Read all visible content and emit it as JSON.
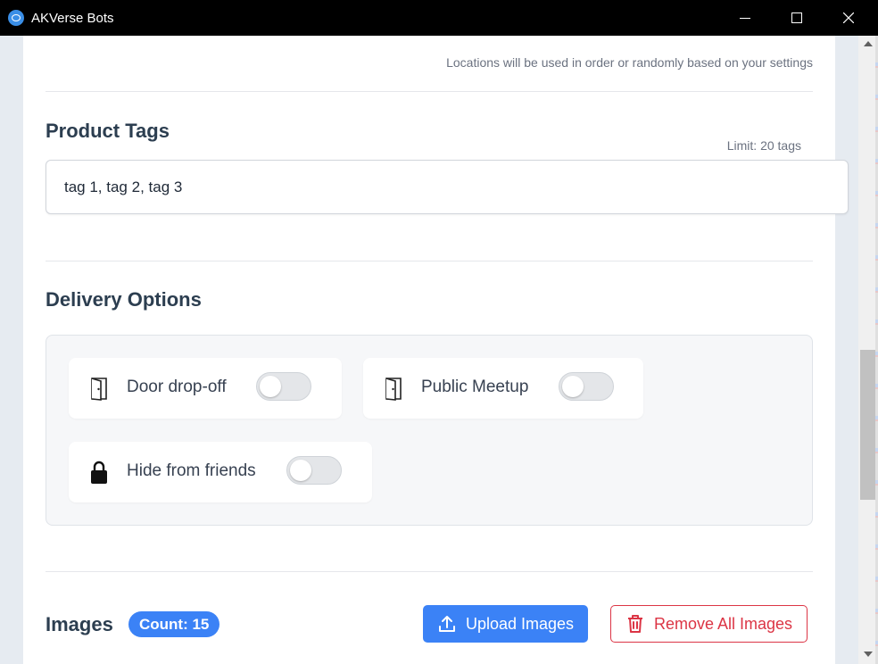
{
  "window": {
    "title": "AKVerse Bots"
  },
  "locations": {
    "hint": "Locations will be used in order or randomly based on your settings"
  },
  "product_tags": {
    "title": "Product Tags",
    "limit": "Limit: 20 tags",
    "value": "tag 1, tag 2, tag 3"
  },
  "delivery": {
    "title": "Delivery Options",
    "options": [
      {
        "label": "Door drop-off",
        "icon": "door-icon",
        "enabled": false
      },
      {
        "label": "Public Meetup",
        "icon": "door-icon",
        "enabled": false
      },
      {
        "label": "Hide from friends",
        "icon": "lock-icon",
        "enabled": false
      }
    ]
  },
  "images": {
    "title": "Images",
    "count_label": "Count: 15",
    "upload_label": "Upload Images",
    "remove_label": "Remove All Images"
  },
  "colors": {
    "primary": "#3b82f6",
    "danger": "#dc3545",
    "heading": "#2c3e50"
  }
}
